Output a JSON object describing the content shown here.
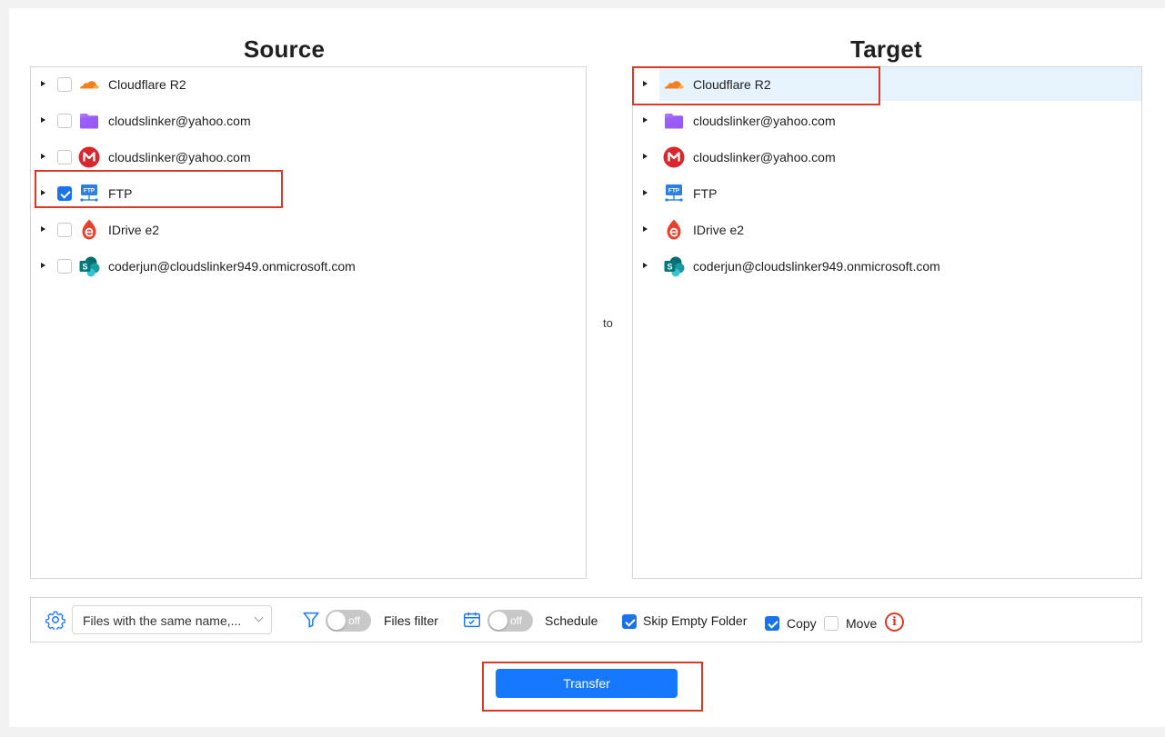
{
  "headings": {
    "source": "Source",
    "target": "Target"
  },
  "connector_text": "to",
  "source_items": [
    {
      "label": "Cloudflare R2",
      "icon": "cloudflare-icon",
      "checked": false
    },
    {
      "label": "cloudslinker@yahoo.com",
      "icon": "folder-purple-icon",
      "checked": false
    },
    {
      "label": "cloudslinker@yahoo.com",
      "icon": "mega-icon",
      "checked": false
    },
    {
      "label": "FTP",
      "icon": "ftp-icon",
      "checked": true
    },
    {
      "label": "IDrive e2",
      "icon": "idrive-icon",
      "checked": false
    },
    {
      "label": "coderjun@cloudslinker949.onmicrosoft.com",
      "icon": "sharepoint-icon",
      "checked": false
    }
  ],
  "target_items": [
    {
      "label": "Cloudflare R2",
      "icon": "cloudflare-icon",
      "selected": true
    },
    {
      "label": "cloudslinker@yahoo.com",
      "icon": "folder-purple-icon",
      "selected": false
    },
    {
      "label": "cloudslinker@yahoo.com",
      "icon": "mega-icon",
      "selected": false
    },
    {
      "label": "FTP",
      "icon": "ftp-icon",
      "selected": false
    },
    {
      "label": "IDrive e2",
      "icon": "idrive-icon",
      "selected": false
    },
    {
      "label": "coderjun@cloudslinker949.onmicrosoft.com",
      "icon": "sharepoint-icon",
      "selected": false
    }
  ],
  "toolbar": {
    "conflict_select_value": "Files with the same name,...",
    "files_filter": {
      "toggle_text": "off",
      "label": "Files filter"
    },
    "schedule": {
      "toggle_text": "off",
      "label": "Schedule"
    },
    "skip_empty_folder": {
      "label": "Skip Empty Folder",
      "checked": true
    },
    "copy": {
      "label": "Copy",
      "checked": true
    },
    "move": {
      "label": "Move",
      "checked": false
    },
    "info_glyph": "i"
  },
  "transfer_label": "Transfer",
  "colors": {
    "accent": "#1677ff",
    "checkbox_blue": "#1a73e8",
    "highlight_red": "#d93a26",
    "selected_row": "#e6f2fc"
  }
}
